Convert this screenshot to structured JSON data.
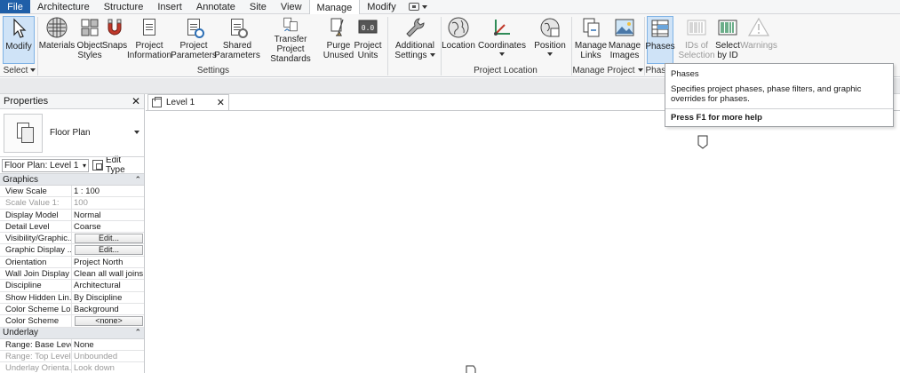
{
  "menu": {
    "file": "File",
    "tabs": [
      "Architecture",
      "Structure",
      "Insert",
      "Annotate",
      "Site",
      "View",
      "Manage",
      "Modify"
    ],
    "active_tab": "Manage"
  },
  "ribbon": {
    "buttons": {
      "modify": "Modify",
      "materials": "Materials",
      "object_styles": "Object Styles",
      "snaps": "Snaps",
      "project_information": "Project Information",
      "project_parameters": "Project Parameters",
      "shared_parameters": "Shared Parameters",
      "transfer_project_standards": "Transfer Project Standards",
      "purge_unused": "Purge Unused",
      "project_units": "Project Units",
      "additional_settings": "Additional Settings",
      "location": "Location",
      "coordinates": "Coordinates",
      "position": "Position",
      "manage_links": "Manage Links",
      "manage_images": "Manage Images",
      "phases": "Phases",
      "ids_of_selection": "IDs of Selection",
      "select_by_id": "Select by ID",
      "warnings": "Warnings"
    },
    "panels": {
      "select": "Select",
      "settings": "Settings",
      "project_location": "Project Location",
      "manage_project": "Manage Project",
      "phasing": "Phasi"
    }
  },
  "tooltip": {
    "title": "Phases",
    "description": "Specifies project phases, phase filters, and graphic overrides for phases.",
    "help": "Press F1 for more help"
  },
  "properties": {
    "title": "Properties",
    "type_name": "Floor Plan",
    "instance_selector": "Floor Plan: Level 1",
    "edit_type": "Edit Type",
    "groups": {
      "graphics": "Graphics",
      "underlay": "Underlay"
    },
    "rows": [
      {
        "k": "View Scale",
        "v": "1 : 100"
      },
      {
        "k": "Scale Value    1:",
        "v": "100"
      },
      {
        "k": "Display Model",
        "v": "Normal"
      },
      {
        "k": "Detail Level",
        "v": "Coarse"
      },
      {
        "k": "Visibility/Graphic...",
        "v": "Edit..."
      },
      {
        "k": "Graphic Display ...",
        "v": "Edit..."
      },
      {
        "k": "Orientation",
        "v": "Project North"
      },
      {
        "k": "Wall Join Display",
        "v": "Clean all wall joins"
      },
      {
        "k": "Discipline",
        "v": "Architectural"
      },
      {
        "k": "Show Hidden Lin...",
        "v": "By Discipline"
      },
      {
        "k": "Color Scheme Lo...",
        "v": "Background"
      },
      {
        "k": "Color Scheme",
        "v": "<none>"
      }
    ],
    "underlay_rows": [
      {
        "k": "Range: Base Level",
        "v": "None"
      },
      {
        "k": "Range: Top Level",
        "v": "Unbounded"
      },
      {
        "k": "Underlay Orienta...",
        "v": "Look down"
      }
    ]
  },
  "view": {
    "tab_label": "Level 1"
  },
  "colors": {
    "file_tab": "#1f5fa8",
    "selected_button": "#cfe3f7"
  }
}
